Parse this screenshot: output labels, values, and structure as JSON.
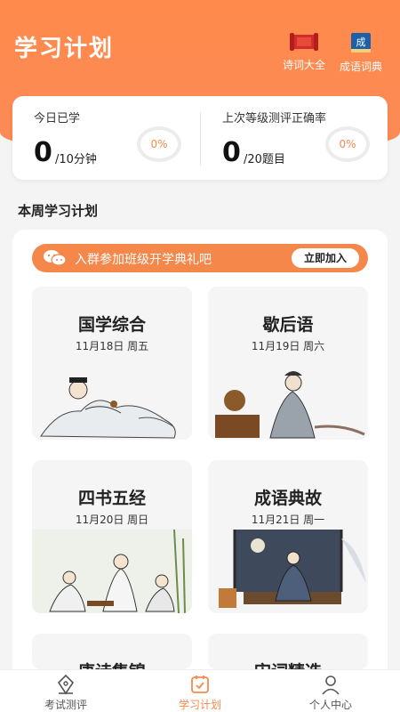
{
  "header": {
    "title": "学习计划",
    "actions": [
      {
        "label": "诗词大全",
        "icon": "scroll-icon"
      },
      {
        "label": "成语词典",
        "icon": "dictionary-book-icon",
        "badge": "成"
      }
    ]
  },
  "stats": {
    "left": {
      "label": "今日已学",
      "value": "0",
      "unit": "/10分钟",
      "percent": "0%"
    },
    "right": {
      "label": "上次等级测评正确率",
      "value": "0",
      "unit": "/20题目",
      "percent": "0%"
    }
  },
  "section": {
    "title": "本周学习计划"
  },
  "banner": {
    "text": "入群参加班级开学典礼吧",
    "button": "立即加入",
    "icon": "wechat-icon"
  },
  "plans": [
    {
      "title": "国学综合",
      "date": "11月18日 周五"
    },
    {
      "title": "歇后语",
      "date": "11月19日 周六"
    },
    {
      "title": "四书五经",
      "date": "11月20日 周日"
    },
    {
      "title": "成语典故",
      "date": "11月21日 周一"
    },
    {
      "title": "唐诗集锦",
      "date": ""
    },
    {
      "title": "宋词精选",
      "date": ""
    }
  ],
  "tabs": [
    {
      "label": "考试测评",
      "icon": "pen-nib-icon"
    },
    {
      "label": "学习计划",
      "icon": "calendar-check-icon",
      "active": true
    },
    {
      "label": "个人中心",
      "icon": "person-icon"
    }
  ],
  "colors": {
    "accent": "#f58a4e",
    "header": "#fb8a55"
  }
}
